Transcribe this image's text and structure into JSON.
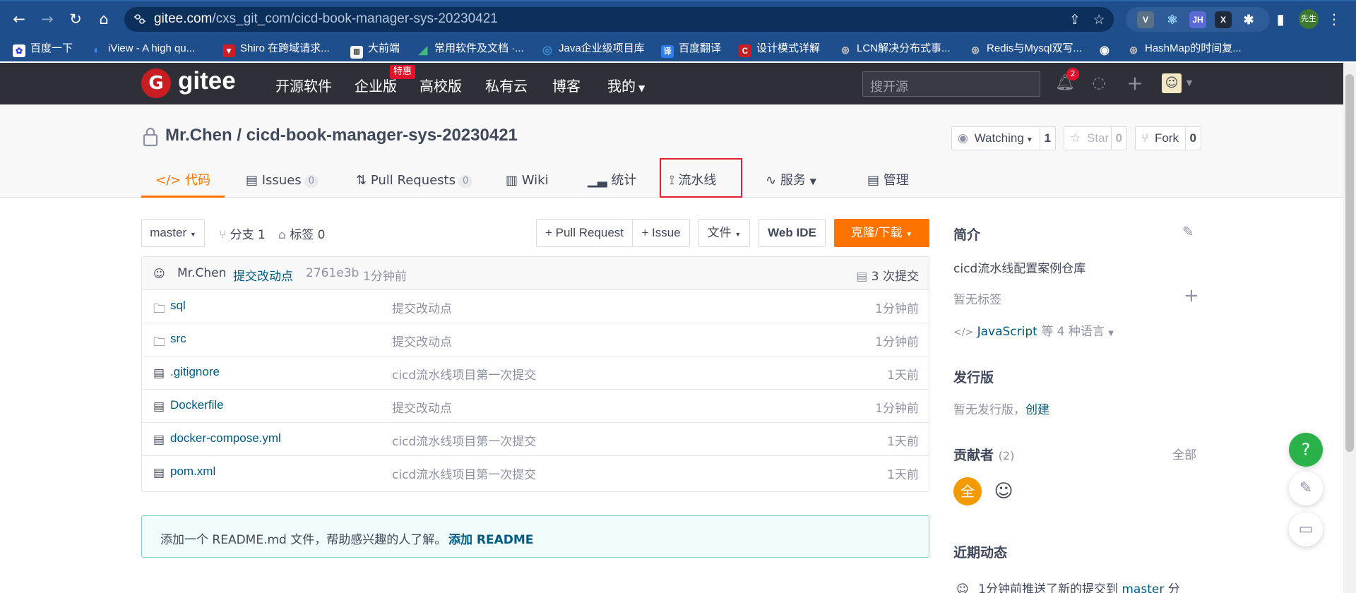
{
  "browser": {
    "url_host": "gitee.com",
    "url_path": "/cxs_git_com/cicd-book-manager-sys-20230421",
    "extensions": [
      "V",
      "⚛",
      "JH",
      "X"
    ],
    "profile_label": "先生"
  },
  "bookmarks": [
    {
      "label": "百度一下",
      "color": "#2932e1"
    },
    {
      "label": "iView - A high qu...",
      "color": "#2d8cf0"
    },
    {
      "label": "Shiro 在跨域请求...",
      "color": "#c92027"
    },
    {
      "label": "大前端",
      "color": "#f5f5f5"
    },
    {
      "label": "常用软件及文档 ·...",
      "color": "#42b983"
    },
    {
      "label": "Java企业级项目库",
      "color": "#3b8fd6"
    },
    {
      "label": "百度翻译",
      "color": "#2e7cf6"
    },
    {
      "label": "设计模式详解",
      "color": "#c71d23"
    },
    {
      "label": "LCN解决分布式事...",
      "color": "#555555"
    },
    {
      "label": "Redis与Mysql双写...",
      "color": "#555555"
    },
    {
      "label": "HashMap的时间复...",
      "color": "#555555"
    }
  ],
  "gitee": {
    "logo_letter": "G",
    "logo_text": "gitee",
    "nav": [
      "开源软件",
      "企业版",
      "高校版",
      "私有云",
      "博客",
      "我的"
    ],
    "promo_badge": "特惠",
    "search_placeholder": "搜开源",
    "notification_count": "2"
  },
  "repo": {
    "owner": "Mr.Chen",
    "name": "cicd-book-manager-sys-20230421",
    "watch_label": "Watching",
    "watch_count": "1",
    "star_label": "Star",
    "star_count": "0",
    "fork_label": "Fork",
    "fork_count": "0",
    "tabs": [
      {
        "label": "代码",
        "count": null
      },
      {
        "label": "Issues",
        "count": "0"
      },
      {
        "label": "Pull Requests",
        "count": "0"
      },
      {
        "label": "Wiki",
        "count": null
      },
      {
        "label": "统计",
        "count": null
      },
      {
        "label": "流水线",
        "count": null
      },
      {
        "label": "服务",
        "count": null
      },
      {
        "label": "管理",
        "count": null
      }
    ]
  },
  "toolbar": {
    "branch": "master",
    "branches_label": "分支 1",
    "tags_label": "标签 0",
    "pull_request": "+ Pull Request",
    "issue": "+ Issue",
    "file": "文件",
    "web_ide": "Web IDE",
    "clone": "克隆/下载"
  },
  "commit": {
    "author": "Mr.Chen",
    "message": "提交改动点",
    "hash": "2761e3b",
    "time": "1分钟前",
    "total": "3 次提交"
  },
  "files": [
    {
      "name": "sql",
      "type": "folder",
      "message": "提交改动点",
      "time": "1分钟前"
    },
    {
      "name": "src",
      "type": "folder",
      "message": "提交改动点",
      "time": "1分钟前"
    },
    {
      "name": ".gitignore",
      "type": "file",
      "message": "cicd流水线项目第一次提交",
      "time": "1天前"
    },
    {
      "name": "Dockerfile",
      "type": "file",
      "message": "提交改动点",
      "time": "1分钟前"
    },
    {
      "name": "docker-compose.yml",
      "type": "file",
      "message": "cicd流水线项目第一次提交",
      "time": "1天前"
    },
    {
      "name": "pom.xml",
      "type": "file",
      "message": "cicd流水线项目第一次提交",
      "time": "1天前"
    }
  ],
  "readme_prompt": {
    "text": "添加一个 README.md 文件，帮助感兴趣的人了解。",
    "link": "添加 README"
  },
  "sidebar": {
    "intro_title": "简介",
    "intro_text": "cicd流水线配置案例仓库",
    "no_tags": "暂无标签",
    "lang_link": "JavaScript",
    "lang_rest": "等 4 种语言",
    "release_title": "发行版",
    "no_release": "暂无发行版，",
    "create": "创建",
    "contributors_title": "贡献者",
    "contributors_count": "(2)",
    "all": "全部",
    "contrib_avatar": "全",
    "activity_title": "近期动态",
    "activity_text": "1分钟前推送了新的提交到",
    "activity_branch": "master",
    "activity_tail": "分"
  },
  "float_buttons": {
    "help": "?"
  }
}
